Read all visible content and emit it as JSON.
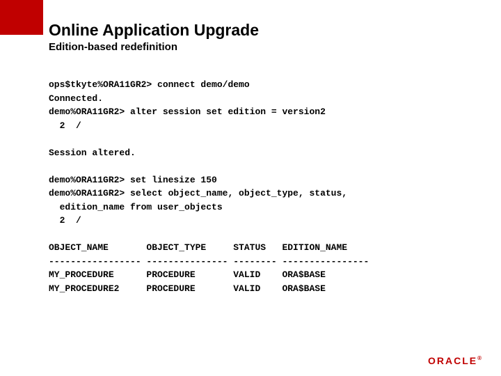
{
  "header": {
    "title": "Online Application Upgrade",
    "subtitle": "Edition-based redefinition"
  },
  "terminal": {
    "block": "ops$tkyte%ORA11GR2> connect demo/demo\nConnected.\ndemo%ORA11GR2> alter session set edition = version2\n  2  /\n\nSession altered.\n\ndemo%ORA11GR2> set linesize 150\ndemo%ORA11GR2> select object_name, object_type, status,\n  edition_name from user_objects\n  2  /\n\nOBJECT_NAME       OBJECT_TYPE     STATUS   EDITION_NAME\n----------------- --------------- -------- ----------------\nMY_PROCEDURE      PROCEDURE       VALID    ORA$BASE\nMY_PROCEDURE2     PROCEDURE       VALID    ORA$BASE"
  },
  "footer": {
    "logo": "ORACLE",
    "reg": "®"
  }
}
